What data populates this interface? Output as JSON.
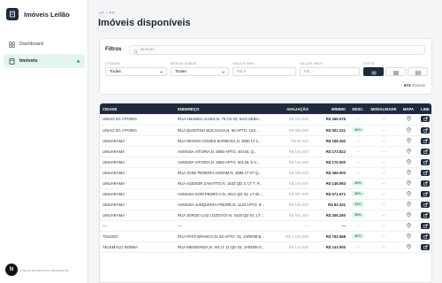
{
  "app": {
    "name": "Imóveis Leilão",
    "footer_initial": "N",
    "footer_text": "Dados atualizados diariamente"
  },
  "sidebar": {
    "items": [
      {
        "label": "Dashboard",
        "icon": "dashboard-icon",
        "active": false
      },
      {
        "label": "Imóveis",
        "icon": "building-icon",
        "active": true
      }
    ]
  },
  "header": {
    "breadcrumb": "UF • PR",
    "title": "Imóveis disponíveis"
  },
  "filters": {
    "title": "Filtros",
    "search_placeholder": "Buscar...",
    "cidade_label": "CIDADE",
    "cidade_value": "Todas",
    "modalidade_label": "MODALIDADE",
    "modalidade_value": "Todas",
    "valor_min_label": "VALOR MÍN",
    "valor_min_placeholder": "R$ 0",
    "valor_max_label": "VALOR MAX",
    "valor_max_placeholder": "R$ ...",
    "vista_label": "VISTA",
    "count_number": "673",
    "count_suffix": " imóveis"
  },
  "colors": {
    "accent": "#1f2a3c",
    "active_bg": "#e2f5ef",
    "discount_bg": "#dff5e9",
    "discount_text": "#2a8a5c"
  },
  "table": {
    "headers": [
      "CIDADE",
      "ENDEREÇO",
      "AVALIAÇÃO",
      "MÍNIMO",
      "DESC.",
      "MODALIDADE",
      "MAPA",
      "LINK"
    ],
    "rows": [
      {
        "cidade": "UNIAO DA VITORIA",
        "endereco": "RUA AMADEU ALVES,N. 75 CS 02, SAO SEBA...",
        "avaliacao": "R$ 223.000",
        "minimo": "R$ 265.076",
        "desc": "",
        "modalidade": "—"
      },
      {
        "cidade": "UNIAO DA VITORIA",
        "endereco": "RUA QUINTINO BOCAIUVA,N. 90 APTO. 103, ...",
        "avaliacao": "R$ 965.000",
        "minimo": "R$ 501.221",
        "desc": "30%",
        "modalidade": "—"
      },
      {
        "cidade": "UMUARAMA",
        "endereco": "RUA REGINA GOMES BARBOSA,N. 3050 LT 1...",
        "avaliacao": "R$ 85.200",
        "minimo": "R$ 168.392",
        "desc": "",
        "modalidade": "—"
      },
      {
        "cidade": "UMUARAMA",
        "endereco": "AVENIDA VITORIA,N. 5800 APTO. 404 BL Q...",
        "avaliacao": "R$ 145.000",
        "minimo": "R$ 173.822",
        "desc": "",
        "modalidade": "—"
      },
      {
        "cidade": "UMUARAMA",
        "endereco": "AVENIDA VITORIA,N. 5800 APTO. 601 BL 5 V...",
        "avaliacao": "R$ 164.200",
        "minimo": "R$ 170.000",
        "desc": "",
        "modalidade": "—"
      },
      {
        "cidade": "UMUARAMA",
        "endereco": "RUA JOSE PEREIRA JARDIM,N. 3595 LT 07 Q...",
        "avaliacao": "R$ 265.000",
        "minimo": "R$ 265.000",
        "desc": "",
        "modalidade": "—"
      },
      {
        "cidade": "UMUARAMA",
        "endereco": "RUA AGENOR ZANATTO,N. 1533 QD 3, LT 7, P...",
        "avaliacao": "R$ 240.000",
        "minimo": "R$ 146.953",
        "desc": "39%",
        "modalidade": "—"
      },
      {
        "cidade": "UMUARAMA",
        "endereco": "AVENIDA DOM PEDRO II,N. 3013 QD 34, LT 02...",
        "avaliacao": "R$ 897.000",
        "minimo": "R$ 571.671",
        "desc": "36%",
        "modalidade": "—"
      },
      {
        "cidade": "UMUARAMA",
        "endereco": "AVENIDA JUNQUEIRA FREIRE,N. 1133 APTO. 9...",
        "avaliacao": "R$ 146.000",
        "minimo": "R$ 83.341",
        "desc": "43%",
        "modalidade": "—"
      },
      {
        "cidade": "UMUARAMA",
        "endereco": "RUA JORGE LUIZ LOZOVOY,N. 4415 QD 01, LT ...",
        "avaliacao": "R$ 904.483",
        "minimo": "R$ 405.260",
        "desc": "55%",
        "modalidade": "—"
      },
      {
        "cidade": "—",
        "endereco": "—",
        "avaliacao": "—",
        "minimo": "—",
        "desc": "",
        "modalidade": "—"
      },
      {
        "cidade": "TOLEDO",
        "endereco": "RUA PATO BRANCO,N. 52 APTO. 01, JARDIM B...",
        "avaliacao": "R$ 1.191.000",
        "minimo": "R$ 752.668",
        "desc": "36%",
        "modalidade": "—"
      },
      {
        "cidade": "TELEMACO BORBA",
        "endereco": "RUA MENDONZA,N. SN LT 11 QD 03, JARDIM S...",
        "avaliacao": "R$ 143.000",
        "minimo": "R$ 143.000",
        "desc": "",
        "modalidade": "—"
      }
    ]
  }
}
